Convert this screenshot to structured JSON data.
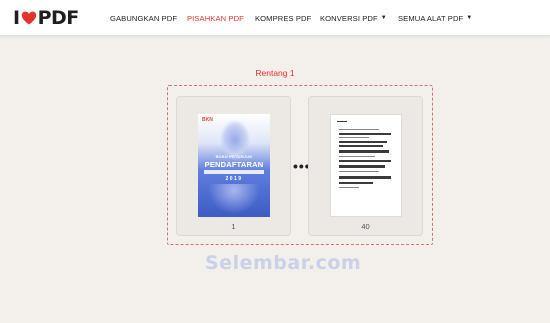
{
  "logo": {
    "text_left": "I",
    "text_right": "PDF",
    "heart_color": "#e5322d"
  },
  "nav": [
    {
      "label": "GABUNGKAN PDF",
      "active": false,
      "dropdown": false
    },
    {
      "label": "PISAHKAN PDF",
      "active": true,
      "dropdown": false
    },
    {
      "label": "KOMPRES PDF",
      "active": false,
      "dropdown": false
    },
    {
      "label": "KONVERSI PDF",
      "active": false,
      "dropdown": true
    },
    {
      "label": "SEMUA ALAT PDF",
      "active": false,
      "dropdown": true
    }
  ],
  "colors": {
    "accent": "#e5322d",
    "background": "#f3f0ec"
  },
  "range": {
    "title": "Rentang 1",
    "first_page": "1",
    "last_page": "40",
    "separator": "•••"
  },
  "cover": {
    "logo": "BKN",
    "line1": "BUKU PETUNJUK",
    "line2": "PENDAFTARAN",
    "line3": "2019"
  },
  "watermark": "Selembar.com"
}
